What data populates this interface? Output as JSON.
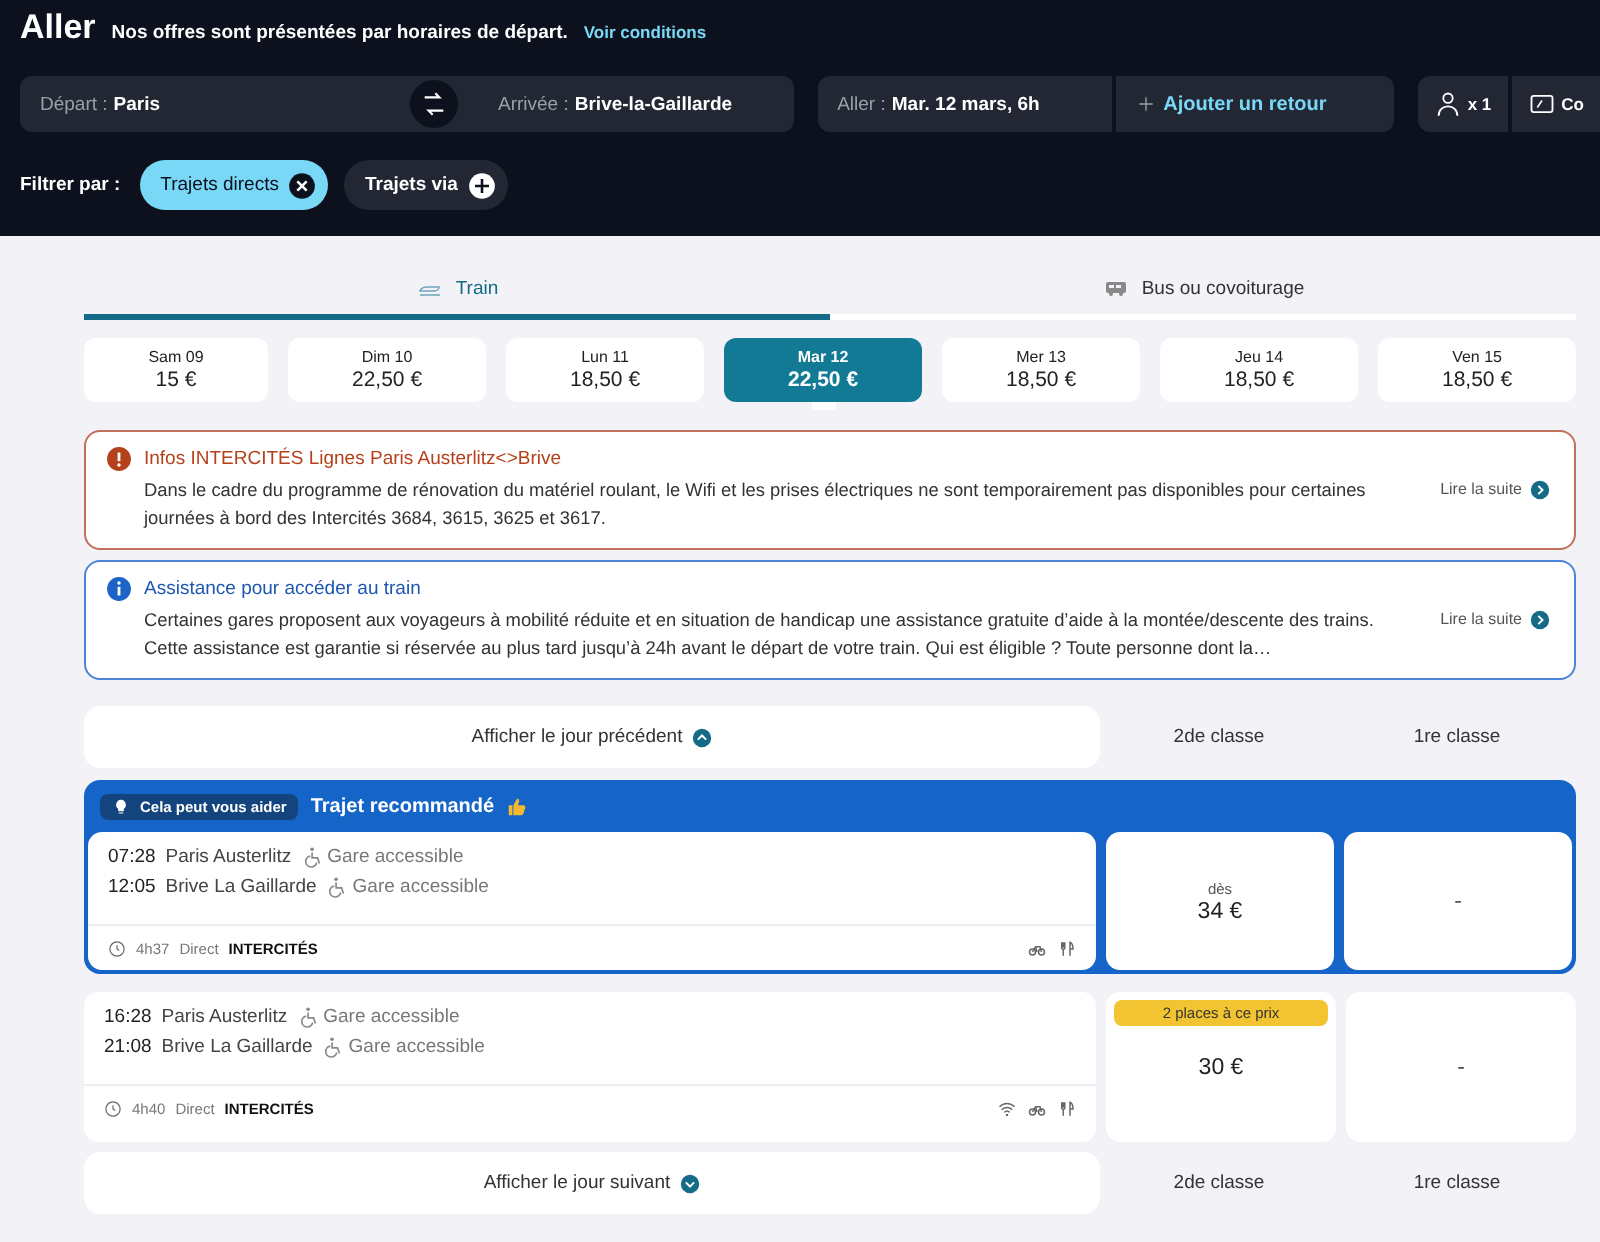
{
  "header": {
    "title": "Aller",
    "subtitle": "Nos offres sont présentées par horaires de départ.",
    "link": "Voir conditions"
  },
  "search": {
    "departure": {
      "label": "Départ :",
      "value": "Paris"
    },
    "arrival": {
      "label": "Arrivée :",
      "value": "Brive-la-Gaillarde"
    },
    "outbound": {
      "label": "Aller :",
      "value": "Mar. 12 mars, 6h"
    },
    "add_return": "Ajouter un retour",
    "passengers": "x 1",
    "card": "Co"
  },
  "filters": {
    "label": "Filtrer par :",
    "items": [
      {
        "label": "Trajets directs",
        "selected": true
      },
      {
        "label": "Trajets via",
        "selected": false
      }
    ]
  },
  "modes": [
    {
      "kind": "train",
      "label": "Train",
      "selected": true
    },
    {
      "kind": "bus",
      "label": "Bus ou covoiturage",
      "selected": false
    }
  ],
  "dates": [
    {
      "day": "Sam 09",
      "price": "15 €",
      "selected": false
    },
    {
      "day": "Dim 10",
      "price": "22,50 €",
      "selected": false
    },
    {
      "day": "Lun 11",
      "price": "18,50 €",
      "selected": false
    },
    {
      "day": "Mar 12",
      "price": "22,50 €",
      "selected": true
    },
    {
      "day": "Mer 13",
      "price": "18,50 €",
      "selected": false
    },
    {
      "day": "Jeu 14",
      "price": "18,50 €",
      "selected": false
    },
    {
      "day": "Ven 15",
      "price": "18,50 €",
      "selected": false
    }
  ],
  "alerts": [
    {
      "kind": "warning",
      "title": "Infos INTERCITÉS Lignes Paris Austerlitz<>Brive",
      "text": "Dans le cadre du programme de rénovation du matériel roulant, le Wifi et les prises électriques ne sont temporairement pas disponibles pour certaines journées à bord des Intercités 3684, 3615, 3625 et 3617.",
      "link": "Lire la suite"
    },
    {
      "kind": "info",
      "title": "Assistance pour accéder au train",
      "text": "Certaines gares proposent aux voyageurs à mobilité réduite et en situation de handicap une assistance gratuite d’aide à la montée/descente des trains. Cette assistance est garantie si réservée au plus tard jusqu’à 24h avant le départ de votre train. Qui est éligible ? Toute personne dont la…",
      "link": "Lire la suite"
    }
  ],
  "previous_day": {
    "label": "Afficher le jour précédent",
    "classes": [
      "2de classe",
      "1re classe"
    ]
  },
  "journeys": [
    {
      "recommended": true,
      "tag": "Cela peut vous aider",
      "headline": "Trajet recommandé",
      "departure": {
        "time": "07:28",
        "station": "Paris Austerlitz",
        "access": "Gare accessible"
      },
      "arrival": {
        "time": "12:05",
        "station": "Brive La Gaillarde",
        "access": "Gare accessible"
      },
      "duration": "4h37",
      "type": "Direct",
      "carrier": "INTERCITÉS",
      "amenities": [
        {
          "kind": "bike"
        },
        {
          "kind": "food"
        }
      ],
      "second_class": {
        "prefix": "dès",
        "price": "34 €"
      },
      "first_class": {
        "price": "-"
      }
    },
    {
      "recommended": false,
      "departure": {
        "time": "16:28",
        "station": "Paris Austerlitz",
        "access": "Gare accessible"
      },
      "arrival": {
        "time": "21:08",
        "station": "Brive La Gaillarde",
        "access": "Gare accessible"
      },
      "duration": "4h40",
      "type": "Direct",
      "carrier": "INTERCITÉS",
      "amenities": [
        {
          "kind": "wifi"
        },
        {
          "kind": "bike"
        },
        {
          "kind": "food"
        }
      ],
      "second_class": {
        "badge": "2 places à ce prix",
        "price": "30 €"
      },
      "first_class": {
        "price": "-"
      }
    }
  ],
  "next_day": {
    "label": "Afficher le jour suivant",
    "classes": [
      "2de classe",
      "1re classe"
    ]
  }
}
